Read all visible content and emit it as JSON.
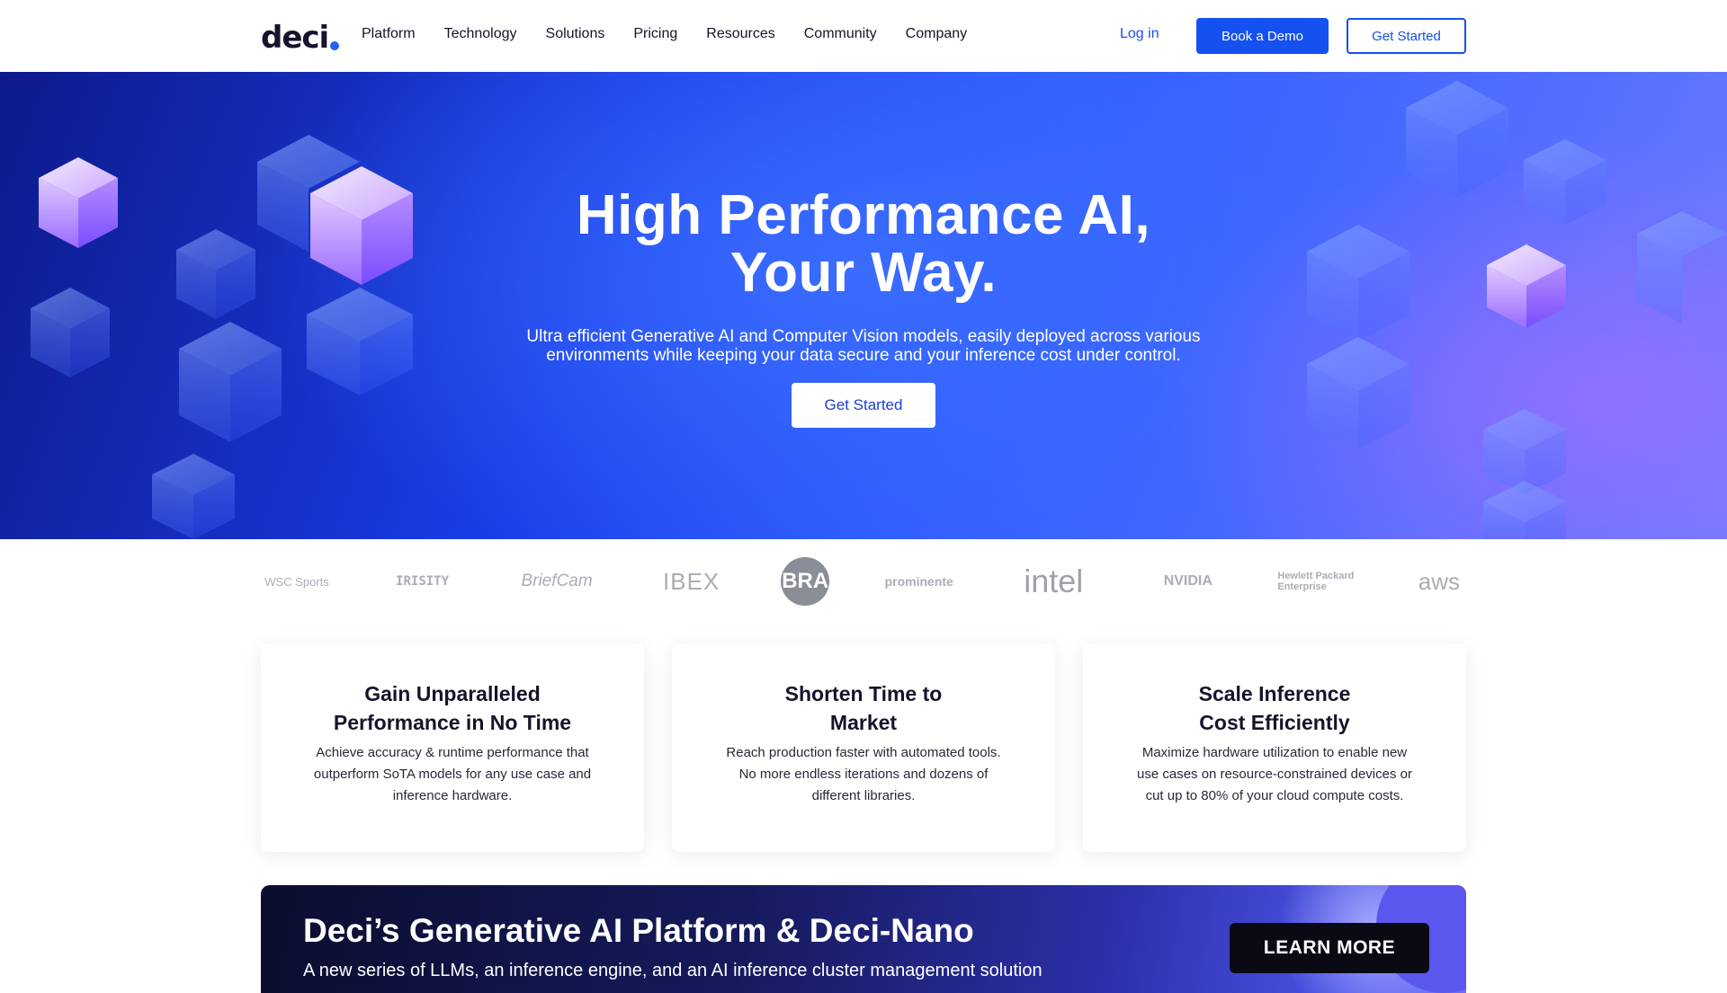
{
  "nav": {
    "logo": "deci",
    "menu": [
      "Platform",
      "Technology",
      "Solutions",
      "Pricing",
      "Resources",
      "Community",
      "Company"
    ],
    "login": "Log in",
    "book_demo": "Book a Demo",
    "get_started": "Get Started"
  },
  "hero": {
    "title_line1": "High Performance AI,",
    "title_line2": "Your Way.",
    "subtitle_line1": "Ultra efficient Generative AI and Computer Vision models, easily deployed across various",
    "subtitle_line2": "environments while keeping your data secure and your inference cost under control.",
    "cta": "Get Started"
  },
  "logos": [
    "WSC Sports",
    "IRISITY",
    "BriefCam",
    "IBEX",
    "BRA",
    "prominente",
    "intel",
    "NVIDIA",
    "Hewlett Packard Enterprise",
    "aws"
  ],
  "cards": [
    {
      "title_line1": "Gain Unparalleled",
      "title_line2": "Performance in No Time",
      "body_line1": "Achieve accuracy & runtime performance that",
      "body_line2": "outperform SoTA models for any use case and",
      "body_line3": "inference hardware."
    },
    {
      "title_line1": "Shorten Time to",
      "title_line2": "Market",
      "body_line1": "Reach production faster with automated tools.",
      "body_line2": "No more endless iterations and dozens of",
      "body_line3": "different libraries."
    },
    {
      "title_line1": "Scale Inference",
      "title_line2": "Cost Efficiently",
      "body_line1": "Maximize hardware utilization to enable new",
      "body_line2": "use cases on resource-constrained devices or",
      "body_line3": "cut up to 80% of your cloud compute costs."
    }
  ],
  "banner": {
    "title": "Deci’s Generative AI Platform & Deci-Nano",
    "subtitle": "A new series of LLMs, an inference engine, and an AI inference cluster management solution",
    "cta": "LEARN MORE"
  },
  "colors": {
    "brand_blue": "#1550f0",
    "hero_deep": "#0d1a8a",
    "hero_purple": "#aa6eff"
  }
}
